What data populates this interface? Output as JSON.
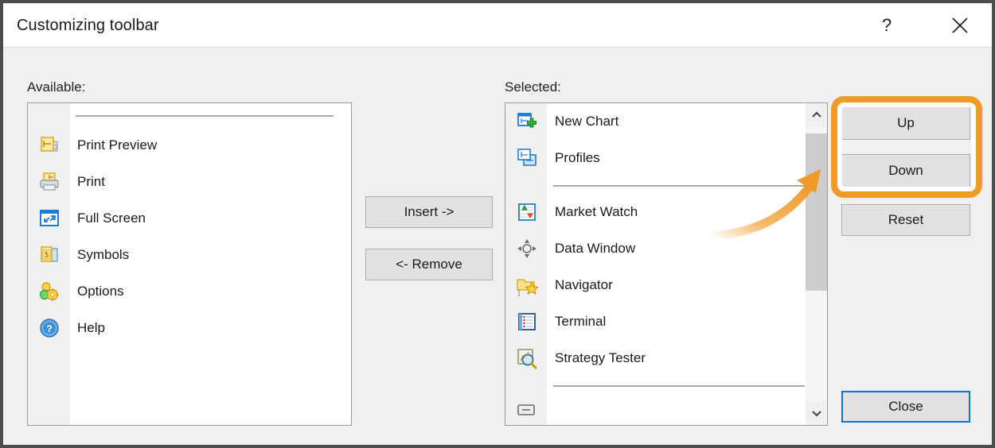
{
  "window": {
    "title": "Customizing toolbar",
    "help_button": "?",
    "close_button": "✕"
  },
  "panels": {
    "available": {
      "label": "Available:",
      "items": [
        {
          "icon": "print-preview-icon",
          "label": "Print Preview"
        },
        {
          "icon": "print-icon",
          "label": "Print"
        },
        {
          "icon": "full-screen-icon",
          "label": "Full Screen"
        },
        {
          "icon": "symbols-icon",
          "label": "Symbols"
        },
        {
          "icon": "options-icon",
          "label": "Options"
        },
        {
          "icon": "help-icon",
          "label": "Help"
        }
      ]
    },
    "selected": {
      "label": "Selected:",
      "items": [
        {
          "icon": "new-chart-icon",
          "label": "New Chart"
        },
        {
          "icon": "profiles-icon",
          "label": "Profiles"
        },
        {
          "icon": "separator",
          "label": ""
        },
        {
          "icon": "market-watch-icon",
          "label": "Market Watch"
        },
        {
          "icon": "data-window-icon",
          "label": "Data Window"
        },
        {
          "icon": "navigator-icon",
          "label": "Navigator"
        },
        {
          "icon": "terminal-icon",
          "label": "Terminal"
        },
        {
          "icon": "strategy-tester-icon",
          "label": "Strategy Tester"
        },
        {
          "icon": "separator",
          "label": ""
        }
      ],
      "scrollbar": {
        "up_arrow": "∧",
        "down_arrow": "∨"
      }
    }
  },
  "transfer_buttons": {
    "insert": "Insert ->",
    "remove": "<- Remove"
  },
  "order_buttons": {
    "up": "Up",
    "down": "Down",
    "reset": "Reset"
  },
  "dialog_buttons": {
    "close": "Close"
  },
  "annotation": {
    "highlight_color": "#f09a28",
    "arrow_color": "#f2a33c",
    "focus_color": "#0a73d4"
  }
}
